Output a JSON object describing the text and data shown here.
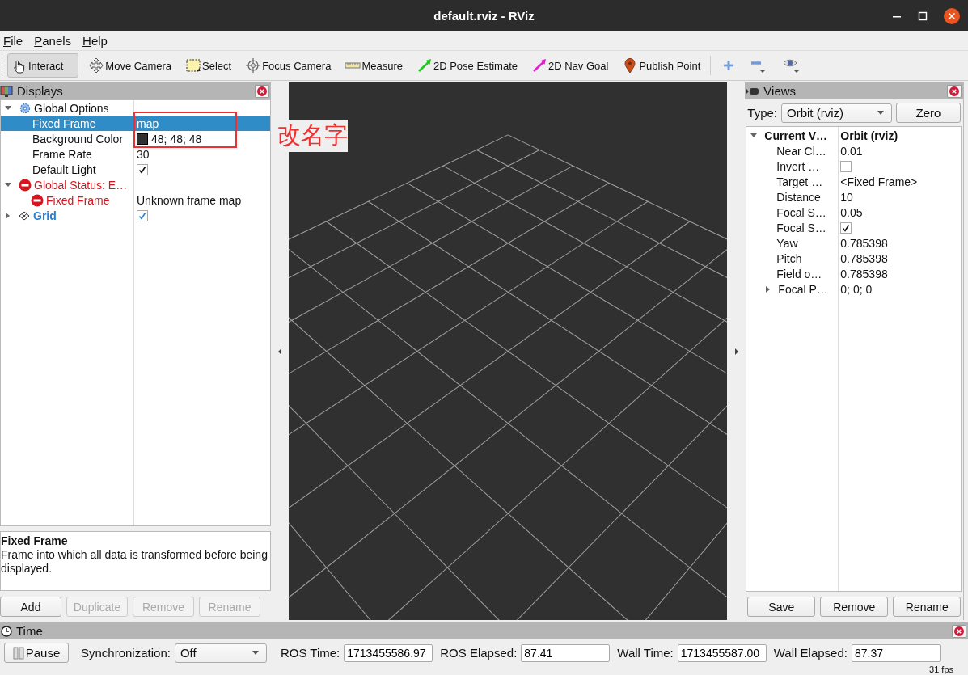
{
  "window": {
    "title": "default.rviz - RViz"
  },
  "menu": [
    {
      "label": "File"
    },
    {
      "label": "Panels"
    },
    {
      "label": "Help"
    }
  ],
  "toolbar": {
    "tools": [
      {
        "kind": "interact",
        "label": "Interact",
        "selected": true
      },
      {
        "kind": "move",
        "label": "Move Camera",
        "selected": false
      },
      {
        "kind": "select",
        "label": "Select",
        "selected": false
      },
      {
        "kind": "focus",
        "label": "Focus Camera",
        "selected": false
      },
      {
        "kind": "measure",
        "label": "Measure",
        "selected": false
      },
      {
        "kind": "pose",
        "label": "2D Pose Estimate",
        "selected": false
      },
      {
        "kind": "nav",
        "label": "2D Nav Goal",
        "selected": false
      },
      {
        "kind": "point",
        "label": "Publish Point",
        "selected": false
      }
    ],
    "extras": [
      {
        "kind": "add"
      },
      {
        "kind": "remove"
      },
      {
        "kind": "view"
      }
    ]
  },
  "displays": {
    "title": "Displays",
    "tree": [
      {
        "kind": "options",
        "name": "Global Options",
        "expanded": true,
        "selected": false,
        "children": [
          {
            "kind": "property",
            "name": "Fixed Frame",
            "value": "map",
            "selected": true
          },
          {
            "kind": "color",
            "name": "Background Color",
            "value": "48; 48; 48",
            "color": "#303030",
            "selected": false
          },
          {
            "kind": "property",
            "name": "Frame Rate",
            "value": "30",
            "selected": false
          },
          {
            "kind": "check",
            "name": "Default Light",
            "checked": true,
            "selected": false
          }
        ]
      },
      {
        "kind": "error",
        "name": "Global Status: E…",
        "expanded": true,
        "selected": false,
        "children": [
          {
            "kind": "error",
            "name": "Fixed Frame",
            "value": "Unknown frame map",
            "selected": false
          }
        ]
      },
      {
        "kind": "display",
        "name": "Grid",
        "expanded": false,
        "checked": true,
        "selected": false
      }
    ],
    "annotation": {
      "text": "改名字"
    },
    "description": {
      "title": "Fixed Frame",
      "text": "Frame into which all data is transformed before being displayed."
    },
    "buttons": [
      {
        "label": "Add",
        "disabled": false
      },
      {
        "label": "Duplicate",
        "disabled": true
      },
      {
        "label": "Remove",
        "disabled": true
      },
      {
        "label": "Rename",
        "disabled": true
      }
    ]
  },
  "views": {
    "title": "Views",
    "type_label": "Type:",
    "type_value": "Orbit (rviz)",
    "zero_button": "Zero",
    "tree": [
      {
        "kind": "header",
        "name": "Current V…",
        "value": "Orbit (rviz)",
        "expanded": true,
        "children": [
          {
            "kind": "property",
            "name": "Near Cl…",
            "value": "0.01"
          },
          {
            "kind": "check",
            "name": "Invert …",
            "checked": false
          },
          {
            "kind": "property",
            "name": "Target …",
            "value": "<Fixed Frame>"
          },
          {
            "kind": "property",
            "name": "Distance",
            "value": "10"
          },
          {
            "kind": "property",
            "name": "Focal S…",
            "value": "0.05"
          },
          {
            "kind": "check",
            "name": "Focal S…",
            "checked": true
          },
          {
            "kind": "property",
            "name": "Yaw",
            "value": "0.785398"
          },
          {
            "kind": "property",
            "name": "Pitch",
            "value": "0.785398"
          },
          {
            "kind": "property",
            "name": "Field o…",
            "value": "0.785398"
          },
          {
            "kind": "property",
            "name": "Focal P…",
            "value": "0; 0; 0",
            "expanded": false
          }
        ]
      }
    ],
    "buttons": [
      {
        "label": "Save"
      },
      {
        "label": "Remove"
      },
      {
        "label": "Rename"
      }
    ]
  },
  "time": {
    "title": "Time",
    "pause_button": "Pause",
    "fields": [
      {
        "kind": "select",
        "label": "Synchronization:",
        "value": "Off"
      },
      {
        "kind": "field",
        "label": "ROS Time:",
        "value": "1713455586.97"
      },
      {
        "kind": "field",
        "label": "ROS Elapsed:",
        "value": "87.41"
      },
      {
        "kind": "field",
        "label": "Wall Time:",
        "value": "1713455587.00"
      },
      {
        "kind": "field",
        "label": "Wall Elapsed:",
        "value": "87.37"
      }
    ],
    "fps": "31 fps"
  }
}
